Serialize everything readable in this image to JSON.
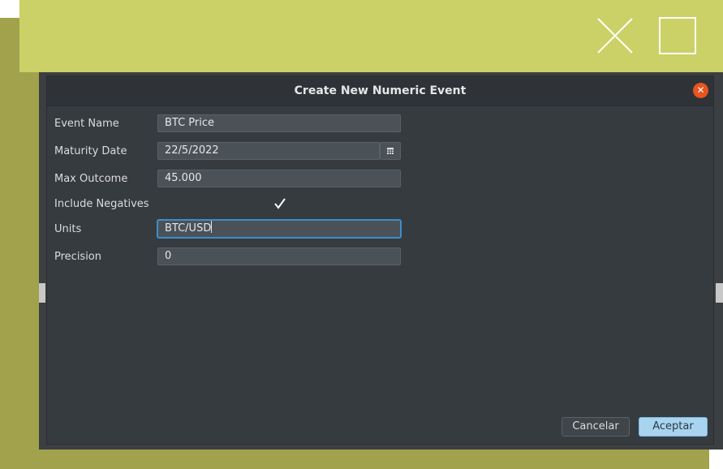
{
  "window": {
    "close_icon": "close-icon",
    "maximize_icon": "maximize-icon"
  },
  "dialog": {
    "title": "Create New Numeric Event",
    "close_icon": "close-icon",
    "fields": {
      "event_name": {
        "label": "Event Name",
        "value": "BTC Price"
      },
      "maturity_date": {
        "label": "Maturity Date",
        "value": "22/5/2022",
        "icon": "calendar-icon"
      },
      "max_outcome": {
        "label": "Max Outcome",
        "value": "45.000"
      },
      "include_negatives": {
        "label": "Include Negatives",
        "checked": true
      },
      "units": {
        "label": "Units",
        "value": "BTC/USD"
      },
      "precision": {
        "label": "Precision",
        "value": "0"
      }
    },
    "buttons": {
      "cancel": "Cancelar",
      "ok": "Aceptar"
    }
  },
  "colors": {
    "accent": "#3d8ec9",
    "close": "#e9541f",
    "primary_button": "#a8d4ef"
  }
}
